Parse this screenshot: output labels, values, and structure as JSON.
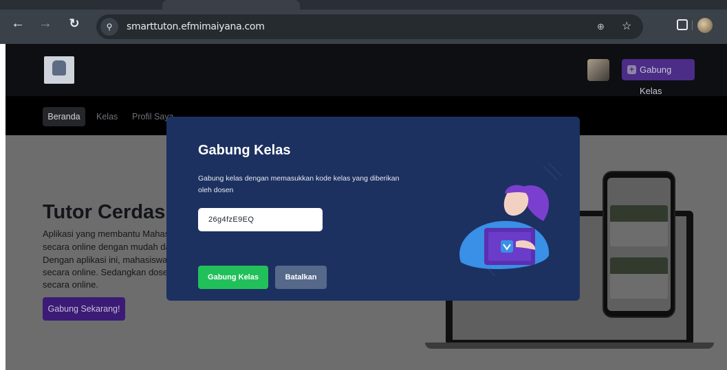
{
  "browser": {
    "url": "smarttuton.efmimaiyana.com"
  },
  "header": {
    "join_button_label": "Gabung Kelas"
  },
  "nav": {
    "items": [
      {
        "label": "Beranda",
        "active": true
      },
      {
        "label": "Kelas",
        "active": false
      },
      {
        "label": "Profil Saya",
        "active": false
      }
    ]
  },
  "hero": {
    "title": "Tutor Cerdas",
    "lines": [
      "Aplikasi yang membantu Mahas",
      "secara online dengan mudah da",
      "Dengan aplikasi ini, mahasiswa",
      "secara online. Sedangkan dose",
      "secara online."
    ],
    "cta_label": "Gabung Sekarang!"
  },
  "modal": {
    "title": "Gabung Kelas",
    "description": "Gabung kelas dengan memasukkan kode kelas yang diberikan oleh dosen",
    "code_value": "26g4fzE9EQ",
    "join_label": "Gabung Kelas",
    "cancel_label": "Batalkan"
  },
  "colors": {
    "modal_bg": "#1c3160",
    "join_green": "#22c05b",
    "cancel_gray": "#56698a",
    "brand_purple": "#6a3cc9"
  },
  "icons": [
    "back-icon",
    "forward-icon",
    "reload-icon",
    "site-info-icon",
    "zoom-icon",
    "star-icon",
    "extensions-icon",
    "profile-icon",
    "plus-icon"
  ]
}
